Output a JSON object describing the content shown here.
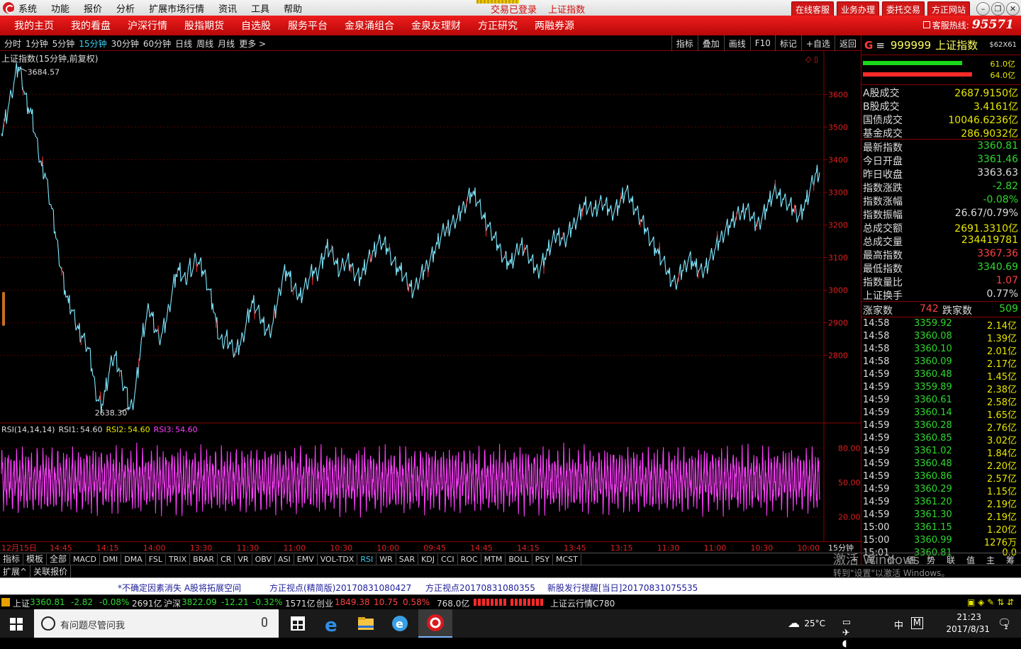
{
  "titlebar": {
    "menu": [
      "系统",
      "功能",
      "报价",
      "分析",
      "扩展市场行情",
      "资讯",
      "工具",
      "帮助"
    ],
    "login_status": "交易已登录",
    "window_title": "上证指数",
    "buttons": [
      "在线客服",
      "业务办理",
      "委托交易",
      "方正网站"
    ]
  },
  "nav": {
    "items": [
      "我的主页",
      "我的看盘",
      "沪深行情",
      "股指期货",
      "自选股",
      "服务平台",
      "金泉涌组合",
      "金泉友理财",
      "方正研究",
      "两融券源"
    ],
    "hotline_label": "客服热线:",
    "hotline_number": "95571"
  },
  "periods": {
    "items": [
      "分时",
      "1分钟",
      "5分钟",
      "15分钟",
      "30分钟",
      "60分钟",
      "日线",
      "周线",
      "月线",
      "更多 >"
    ],
    "active_index": 3,
    "tools": [
      "指标",
      "叠加",
      "画线",
      "F10",
      "标记",
      "+自选",
      "返回"
    ]
  },
  "chart_data": {
    "type": "line",
    "title": "上证指数(15分钟,前复权)",
    "y_ticks": [
      3600,
      3500,
      3400,
      3300,
      3200,
      3100,
      3000,
      2900,
      2800
    ],
    "ylim": [
      2595,
      3720
    ],
    "max_label": "3684.57",
    "min_label": "2638.30",
    "series": [
      {
        "color": "#7fe8ff",
        "values": [
          3480,
          3520,
          3560,
          3600,
          3650,
          3684,
          3660,
          3600,
          3560,
          3540,
          3480,
          3420,
          3380,
          3360,
          3300,
          3250,
          3180,
          3120,
          3060,
          3000,
          2960,
          2940,
          2900,
          2880,
          2860,
          2840,
          2820,
          2760,
          2700,
          2660,
          2650,
          2690,
          2740,
          2780,
          2800,
          2760,
          2720,
          2700,
          2640,
          2650,
          2700,
          2780,
          2860,
          2900,
          2940,
          2920,
          2880,
          2850,
          2870,
          2900,
          2950,
          3000,
          3050,
          3060,
          3040,
          3020,
          3080,
          3060,
          3100,
          3080,
          3060,
          3040,
          3000,
          2960,
          2900,
          2850,
          2830,
          2860,
          2840,
          2820,
          2810,
          2830,
          2860,
          2900,
          2940,
          2960,
          2940,
          2920,
          2900,
          2880,
          2870,
          2900,
          2950,
          3000,
          3050,
          3060,
          3040,
          3000,
          2990,
          2980,
          3000,
          3020,
          3040,
          3060,
          3050,
          3080,
          3100,
          3130,
          3120,
          3100,
          3080,
          3060,
          3080,
          3090,
          3080,
          3060,
          3050,
          3040,
          3060,
          3080,
          3100,
          3120,
          3140,
          3150,
          3140,
          3130,
          3110,
          3090,
          3070,
          3060,
          3040,
          3020,
          3010,
          3000,
          3020,
          3040,
          3060,
          3080,
          3100,
          3120,
          3140,
          3160,
          3180,
          3190,
          3200,
          3210,
          3220,
          3240,
          3260,
          3280,
          3300,
          3290,
          3270,
          3240,
          3220,
          3200,
          3180,
          3160,
          3140,
          3120,
          3100,
          3090,
          3080,
          3100,
          3120,
          3140,
          3130,
          3110,
          3090,
          3070,
          3060,
          3080,
          3100,
          3120,
          3140,
          3160,
          3170,
          3160,
          3150,
          3170,
          3190,
          3210,
          3230,
          3250,
          3260,
          3250,
          3240,
          3250,
          3260,
          3270,
          3260,
          3250,
          3240,
          3250,
          3260,
          3280,
          3300,
          3290,
          3270,
          3250,
          3230,
          3210,
          3190,
          3170,
          3150,
          3130,
          3110,
          3090,
          3070,
          3050,
          3030,
          3020,
          3040,
          3060,
          3080,
          3100,
          3090,
          3070,
          3060,
          3050,
          3070,
          3090,
          3110,
          3130,
          3150,
          3170,
          3190,
          3200,
          3210,
          3220,
          3230,
          3240,
          3250,
          3240,
          3220,
          3200,
          3210,
          3230,
          3250,
          3270,
          3290,
          3300,
          3290,
          3280,
          3270,
          3260,
          3250,
          3240,
          3230,
          3250,
          3270,
          3300,
          3330,
          3360,
          3361
        ]
      }
    ],
    "rsi": {
      "label": "RSI(14,14,14)",
      "rsi1_label": "RSI1:",
      "rsi1": "54.60",
      "rsi2_label": "RSI2:",
      "rsi2": "54.60",
      "rsi3_label": "RSI3:",
      "rsi3": "54.60",
      "y_ticks": [
        "80.00",
        "50.00",
        "20.00"
      ],
      "ylim": [
        0,
        100
      ]
    },
    "x_ticks": [
      "12月15日",
      "14:45",
      "14:15",
      "14:00",
      "13:30",
      "11:30",
      "11:00",
      "10:30",
      "10:00",
      "09:45",
      "14:45",
      "14:15",
      "13:45",
      "13:15",
      "11:30",
      "11:00",
      "10:30",
      "10:00"
    ],
    "period_label": "15分钟"
  },
  "tabs": {
    "items": [
      "指标",
      "模板",
      "全部",
      "MACD",
      "DMI",
      "DMA",
      "FSL",
      "TRIX",
      "BRAR",
      "CR",
      "VR",
      "OBV",
      "ASI",
      "EMV",
      "VOL-TDX",
      "RSI",
      "WR",
      "SAR",
      "KDJ",
      "CCI",
      "ROC",
      "MTM",
      "BOLL",
      "PSY",
      "MCST"
    ],
    "active": "RSI",
    "plus": "+"
  },
  "subtabs": {
    "items": [
      "扩展^",
      "关联报价"
    ],
    "right_items": [
      "笔",
      "价",
      "细",
      "势",
      "联",
      "值",
      "主",
      "筹"
    ]
  },
  "news": [
    "*不确定因素消失 A股将拓展空间",
    "方正视点(精简版)20170831080427",
    "方正视点20170831080355",
    "新股发行提醒[当日]20170831075535"
  ],
  "status": {
    "sh_label": "上证",
    "sh_val": "3360.81",
    "sh_chg": "-2.82",
    "sh_pct": "-0.08%",
    "sh_amt": "2691亿",
    "sz_label": "沪深",
    "sz_val": "3822.09",
    "sz_chg": "-12.21",
    "sz_pct": "-0.32%",
    "sz_amt": "1571亿",
    "cy_label": "创业",
    "cy_val": "1849.38",
    "cy_chg": "10.75",
    "cy_pct": "0.58%",
    "cy_amt": "768.0亿",
    "cloud": "上证云行情C780"
  },
  "quote": {
    "logo": "G",
    "menu": "≡",
    "code": "999999",
    "name": "上证指数",
    "tag": "$62X61",
    "bar1_label": "61.0亿",
    "bar2_label": "64.0亿",
    "bar1_fraction": 0.62,
    "bar2_fraction": 0.68,
    "turnover": [
      {
        "k": "A股成交",
        "v": "2687.9150亿"
      },
      {
        "k": "B股成交",
        "v": "3.4161亿"
      },
      {
        "k": "国债成交",
        "v": "10046.6236亿"
      },
      {
        "k": "基金成交",
        "v": "286.9032亿"
      }
    ],
    "stats": [
      {
        "k": "最新指数",
        "v": "3360.81",
        "c": "dn"
      },
      {
        "k": "今日开盘",
        "v": "3361.46",
        "c": "dn"
      },
      {
        "k": "昨日收盘",
        "v": "3363.63",
        "c": "wh"
      },
      {
        "k": "指数涨跌",
        "v": "-2.82",
        "c": "dn"
      },
      {
        "k": "指数涨幅",
        "v": "-0.08%",
        "c": "dn"
      },
      {
        "k": "指数振幅",
        "v": "26.67/0.79%",
        "c": "wh"
      },
      {
        "k": "总成交额",
        "v": "2691.3310亿",
        "c": "yl"
      },
      {
        "k": "总成交量",
        "v": "234419781",
        "c": "yl"
      },
      {
        "k": "最高指数",
        "v": "3367.36",
        "c": "up"
      },
      {
        "k": "最低指数",
        "v": "3340.69",
        "c": "dn"
      },
      {
        "k": "指数量比",
        "v": "1.07",
        "c": "up"
      },
      {
        "k": "上证换手",
        "v": "0.77%",
        "c": "wh"
      }
    ],
    "up_label": "涨家数",
    "up_count": "742",
    "down_label": "跌家数",
    "down_count": "509",
    "ticks": [
      [
        "14:58",
        "3359.92",
        "2.14亿"
      ],
      [
        "14:58",
        "3360.08",
        "1.39亿"
      ],
      [
        "14:58",
        "3360.10",
        "2.01亿"
      ],
      [
        "14:58",
        "3360.09",
        "2.17亿"
      ],
      [
        "14:59",
        "3360.48",
        "1.45亿"
      ],
      [
        "14:59",
        "3359.89",
        "2.38亿"
      ],
      [
        "14:59",
        "3360.61",
        "2.58亿"
      ],
      [
        "14:59",
        "3360.14",
        "1.65亿"
      ],
      [
        "14:59",
        "3360.28",
        "2.76亿"
      ],
      [
        "14:59",
        "3360.85",
        "3.02亿"
      ],
      [
        "14:59",
        "3361.02",
        "1.84亿"
      ],
      [
        "14:59",
        "3360.48",
        "2.20亿"
      ],
      [
        "14:59",
        "3360.86",
        "2.57亿"
      ],
      [
        "14:59",
        "3360.29",
        "1.15亿"
      ],
      [
        "14:59",
        "3361.20",
        "2.19亿"
      ],
      [
        "14:59",
        "3361.30",
        "2.19亿"
      ],
      [
        "15:00",
        "3361.15",
        "1.20亿"
      ],
      [
        "15:00",
        "3360.99",
        "1276万"
      ],
      [
        "15:01",
        "3360.81",
        "0.0"
      ]
    ]
  },
  "taskbar": {
    "search_placeholder": "有问题尽管问我",
    "weather": "25°C",
    "ime": "中",
    "ime2": "M",
    "time": "21:23",
    "date": "2017/8/31",
    "notif": "1"
  },
  "watermark": {
    "line1": "激活 Windows",
    "line2": "转到\"设置\"以激活 Windows。"
  }
}
